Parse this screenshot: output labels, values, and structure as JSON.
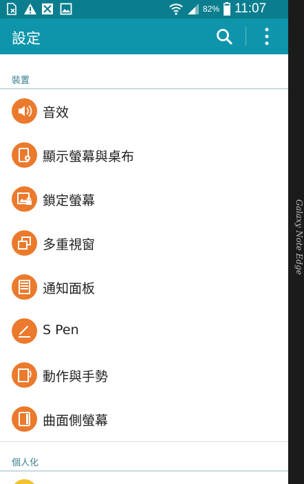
{
  "status_bar": {
    "battery_percent": "82%",
    "time": "11:07",
    "left_icons": [
      "sim-error-icon",
      "warning-icon",
      "blocked-image-icon",
      "picture-icon"
    ],
    "right_icons": [
      "wifi-icon",
      "signal-icon",
      "battery-icon"
    ]
  },
  "app_bar": {
    "title": "設定",
    "actions": [
      "search-icon",
      "more-vert-icon"
    ]
  },
  "sections": [
    {
      "header": "裝置",
      "items": [
        {
          "label": "音效",
          "icon": "sound-icon"
        },
        {
          "label": "顯示螢幕與桌布",
          "icon": "display-icon"
        },
        {
          "label": "鎖定螢幕",
          "icon": "lock-screen-icon"
        },
        {
          "label": "多重視窗",
          "icon": "multi-window-icon"
        },
        {
          "label": "通知面板",
          "icon": "notification-panel-icon"
        },
        {
          "label": "S Pen",
          "icon": "s-pen-icon"
        },
        {
          "label": "動作與手勢",
          "icon": "motion-gesture-icon"
        },
        {
          "label": "曲面側螢幕",
          "icon": "edge-screen-icon"
        }
      ]
    },
    {
      "header": "個人化",
      "items": []
    }
  ],
  "edge_label": "Galaxy Note Edge",
  "colors": {
    "status_bar": "#0a7e8e",
    "app_bar": "#0e95ab",
    "icon_accent": "#eb7a2c",
    "section_header_text": "#3b7f8e"
  }
}
